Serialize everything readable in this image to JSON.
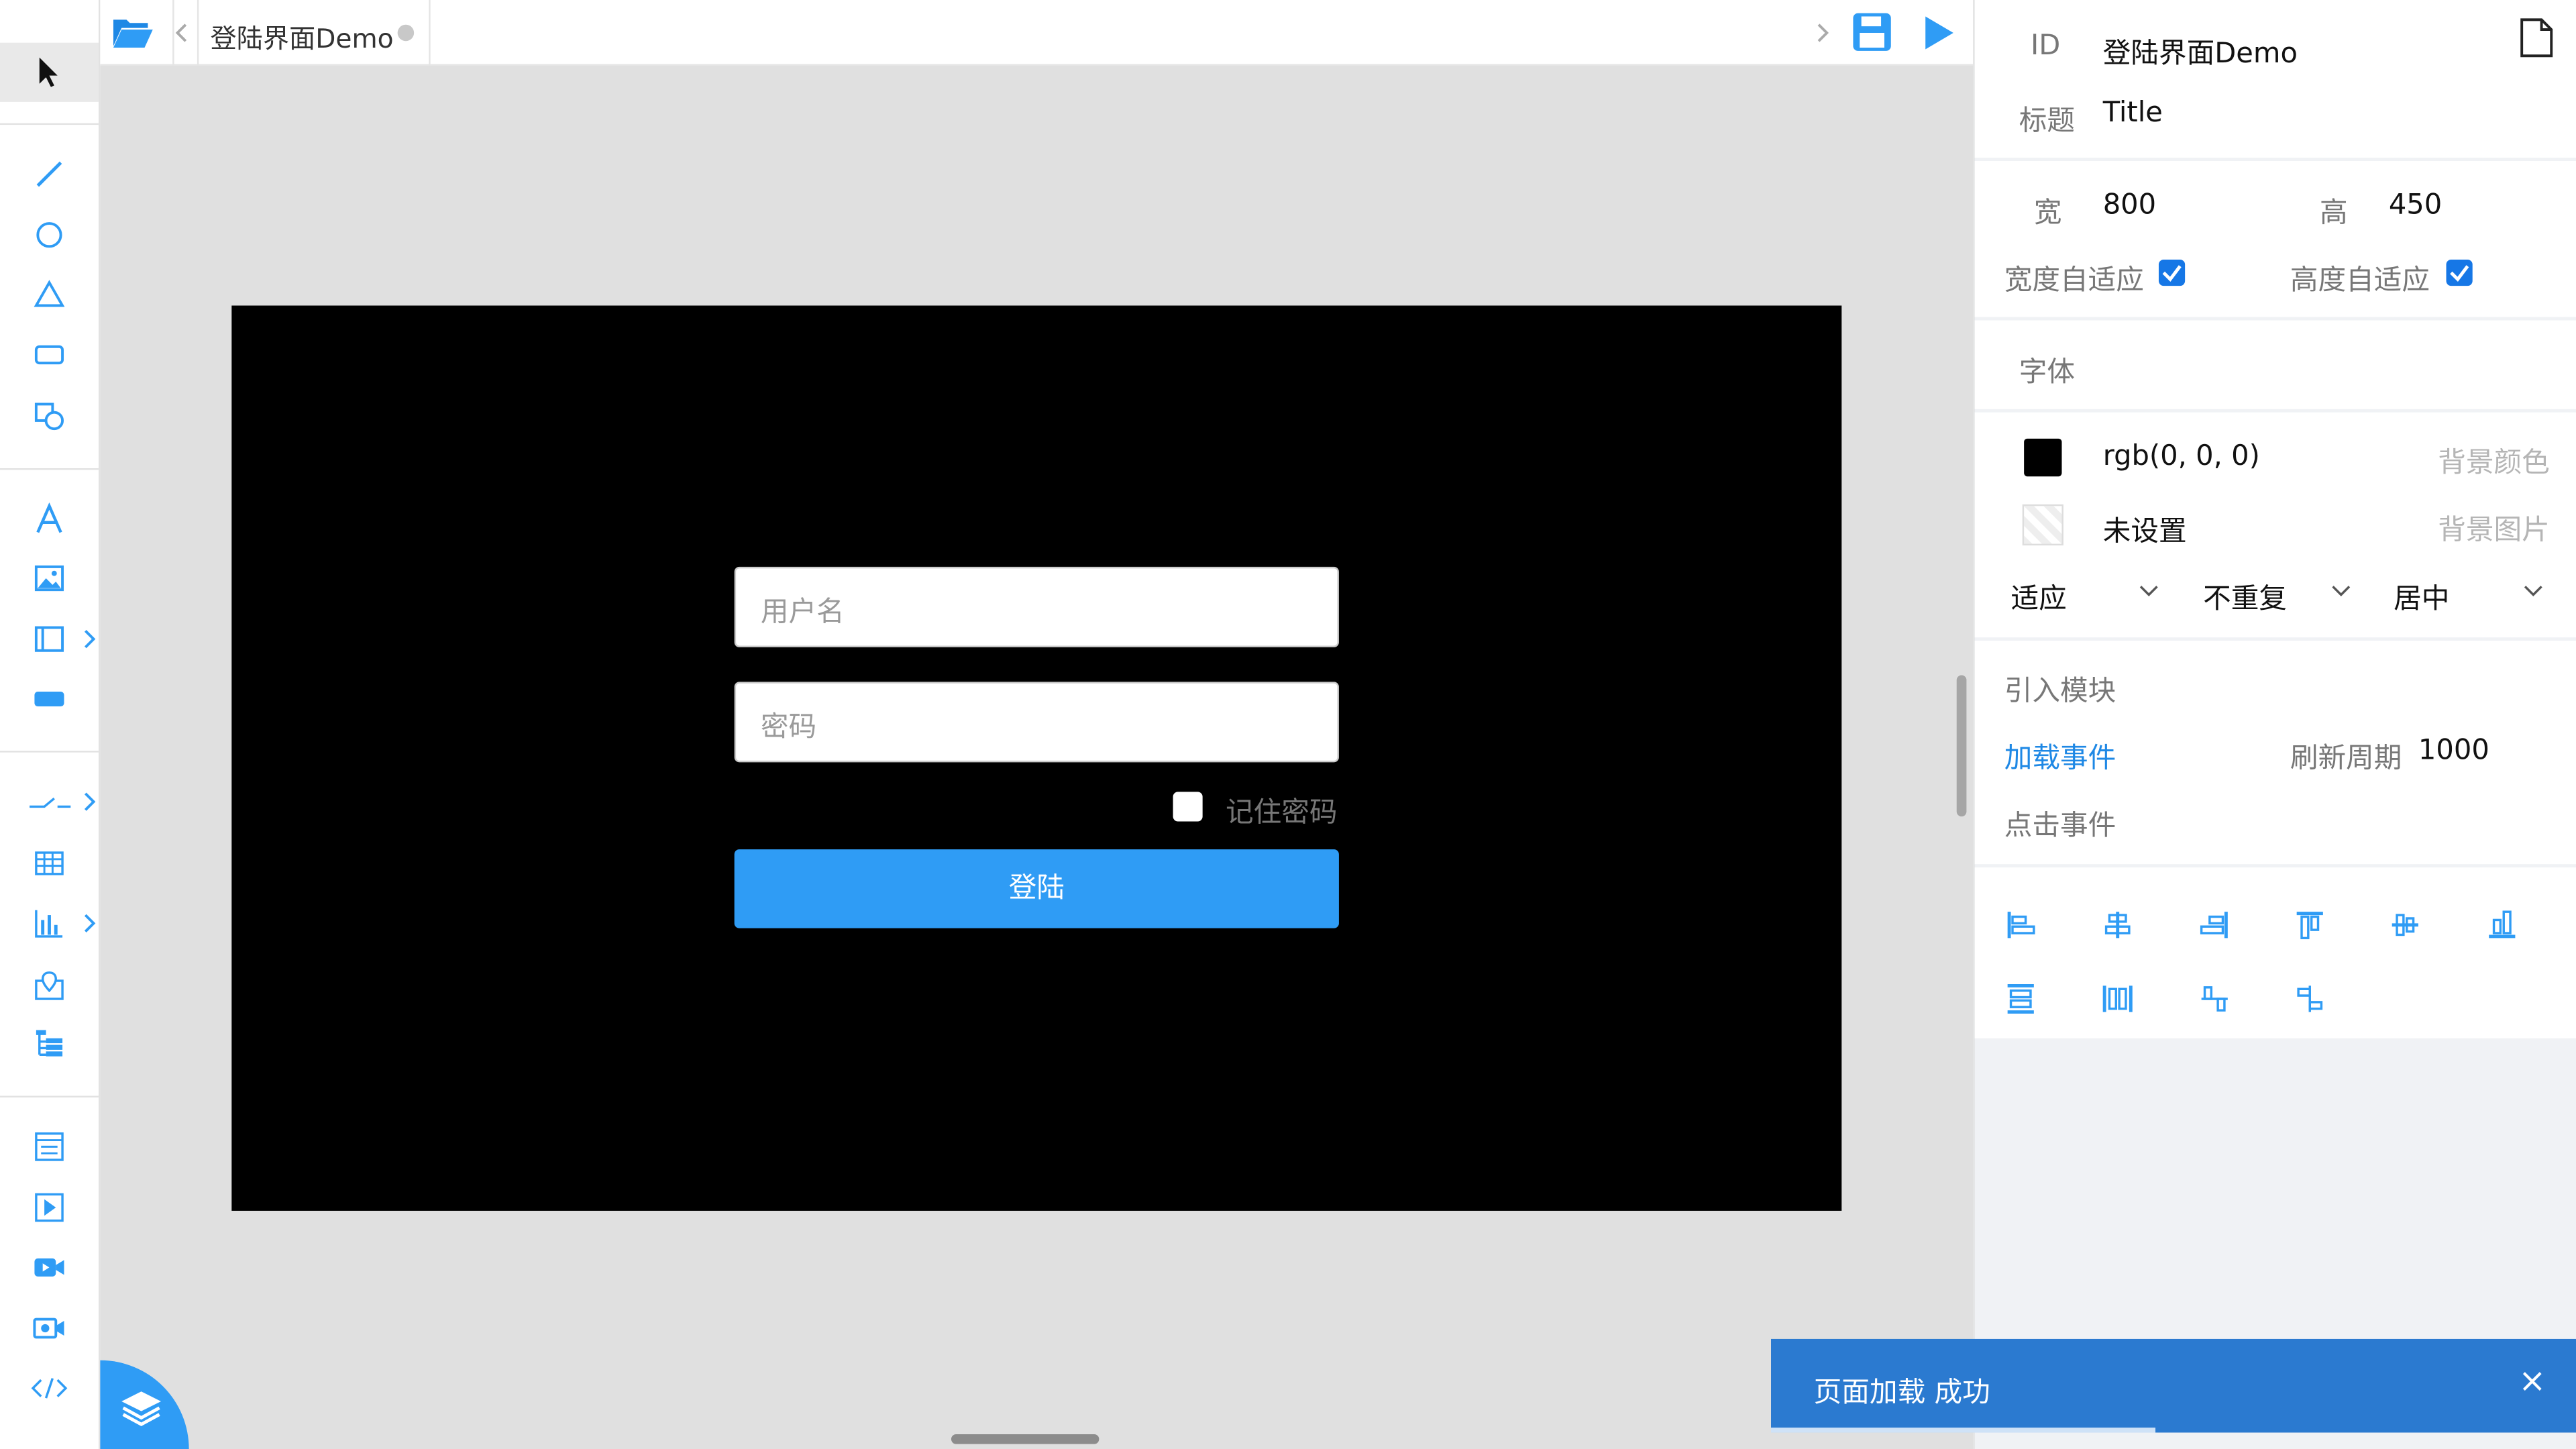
{
  "tab": {
    "title": "登陆界面Demo"
  },
  "form": {
    "username_placeholder": "用户名",
    "password_placeholder": "密码",
    "remember": "记住密码",
    "login": "登陆"
  },
  "panel": {
    "id_label": "ID",
    "id_value": "登陆界面Demo",
    "title_label": "标题",
    "title_value": "Title",
    "width_label": "宽",
    "width_value": "800",
    "height_label": "高",
    "height_value": "450",
    "auto_width": "宽度自适应",
    "auto_height": "高度自适应",
    "font_label": "字体",
    "bg_color_value": "rgb(0, 0, 0)",
    "bg_color_label": "背景颜色",
    "bg_image_value": "未设置",
    "bg_image_label": "背景图片",
    "fit": "适应",
    "repeat": "不重复",
    "position": "居中",
    "import_module": "引入模块",
    "load_event": "加载事件",
    "refresh_label": "刷新周期",
    "refresh_value": "1000",
    "click_event": "点击事件"
  },
  "toast": {
    "message": "页面加载 成功",
    "close": "×"
  },
  "colors": {
    "accent": "#2f9cf5",
    "stage_bg": "#000000",
    "toast": "#2b7ad0"
  },
  "icons": [
    "pointer-icon",
    "line-icon",
    "circle-icon",
    "triangle-icon",
    "rectangle-icon",
    "shapes-icon",
    "text-icon",
    "image-icon",
    "container-icon",
    "button-icon",
    "connector-icon",
    "table-icon",
    "chart-icon",
    "map-icon",
    "tree-icon",
    "form-icon",
    "media-icon",
    "video-icon",
    "camera-icon",
    "code-icon"
  ]
}
